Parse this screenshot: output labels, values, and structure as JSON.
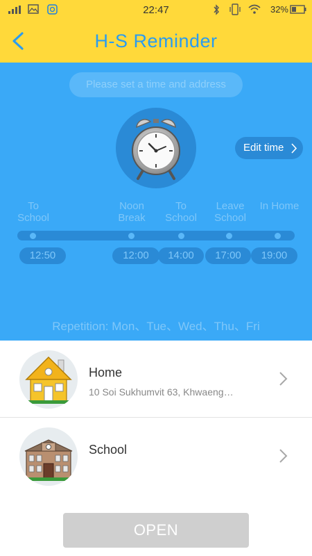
{
  "status_bar": {
    "time": "22:47",
    "battery": "32%"
  },
  "header": {
    "title": "H-S Reminder"
  },
  "panel": {
    "hint": "Please set a time and address",
    "edit_time": "Edit time",
    "labels": [
      {
        "line1": "To",
        "line2": "School"
      },
      {
        "line1": "Noon",
        "line2": "Break"
      },
      {
        "line1": "To",
        "line2": "School"
      },
      {
        "line1": "Leave",
        "line2": "School"
      },
      {
        "line1": "In Home",
        "line2": ""
      }
    ],
    "times": [
      "12:50",
      "12:00",
      "14:00",
      "17:00",
      "19:00"
    ],
    "repetition": "Repetition: Mon、Tue、Wed、Thu、Fri"
  },
  "places": [
    {
      "name": "Home",
      "address": "10 Soi Sukhumvit 63, Khwaeng…"
    },
    {
      "name": "School",
      "address": ""
    }
  ],
  "open_button": "OPEN",
  "colors": {
    "header": "#ffd93a",
    "panel": "#3aa9f7",
    "accent": "#2a9cf0"
  }
}
